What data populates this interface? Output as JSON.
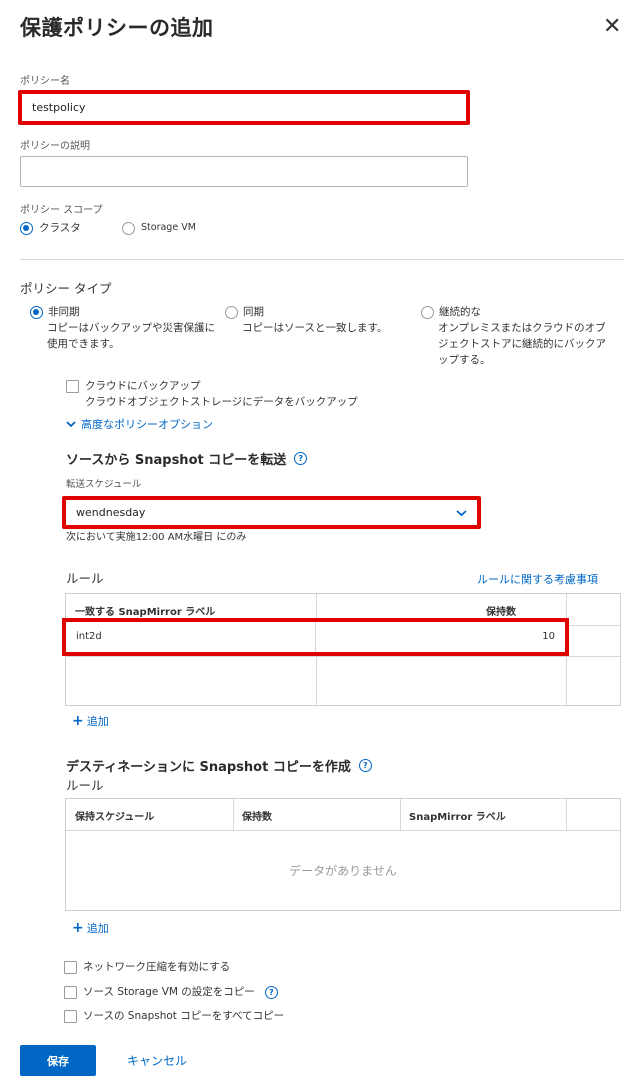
{
  "dialog": {
    "title": "保護ポリシーの追加",
    "close_icon": "close-icon",
    "close_glyph": "✕"
  },
  "policy_name": {
    "label": "ポリシー名",
    "value": "testpolicy"
  },
  "policy_description": {
    "label": "ポリシーの説明",
    "value": ""
  },
  "policy_scope": {
    "label": "ポリシー スコープ",
    "options": [
      {
        "label": "クラスタ",
        "selected": true
      },
      {
        "label": "Storage VM",
        "selected": false
      }
    ]
  },
  "policy_type": {
    "label": "ポリシー タイプ",
    "options": [
      {
        "label": "非同期",
        "desc": [
          "コピーはバックアップや災害保護に",
          "使用できます。"
        ],
        "selected": true
      },
      {
        "label": "同期",
        "desc": [
          "コピーはソースと一致します。"
        ],
        "selected": false
      },
      {
        "label": "継続的な",
        "desc": [
          "オンプレミスまたはクラウドのオブ",
          "ジェクトストアに継続的にバックア",
          "ップする。"
        ],
        "selected": false
      }
    ]
  },
  "cloud_backup": {
    "label": "クラウドにバックアップ",
    "desc": "クラウドオブジェクトストレージにデータをバックアップ",
    "checked": false
  },
  "advanced_options": {
    "label": "高度なポリシーオプション",
    "icon": "chevron-down-icon"
  },
  "transfer": {
    "heading": "ソースから Snapshot コピーを転送",
    "help_icon": "help-icon",
    "help_glyph": "?",
    "schedule_label": "転送スケジュール",
    "schedule_value": "wendnesday",
    "schedule_note": "次において実施12:00 AM水曜日 にのみ",
    "rules_label": "ルール",
    "rules_link": "ルールに関する考慮事項",
    "columns": [
      "一致する SnapMirror ラベル",
      "保持数"
    ],
    "rows": [
      {
        "label": "int2d",
        "count": "10"
      }
    ],
    "add_label": "追加",
    "plus_glyph": "+"
  },
  "destination": {
    "heading": "デスティネーションに Snapshot コピーを作成",
    "rules_label": "ルール",
    "columns": [
      "保持スケジュール",
      "保持数",
      "SnapMirror ラベル"
    ],
    "empty_text": "データがありません",
    "add_label": "追加"
  },
  "options": {
    "network_compression": "ネットワーク圧縮を有効にする",
    "copy_svm_settings": "ソース Storage VM の設定をコピー",
    "copy_all_snapshots": "ソースの Snapshot コピーをすべてコピー"
  },
  "footer": {
    "save_label": "保存",
    "cancel_label": "キャンセル"
  },
  "colors": {
    "accent": "#0067c5",
    "highlight": "#e00000"
  }
}
